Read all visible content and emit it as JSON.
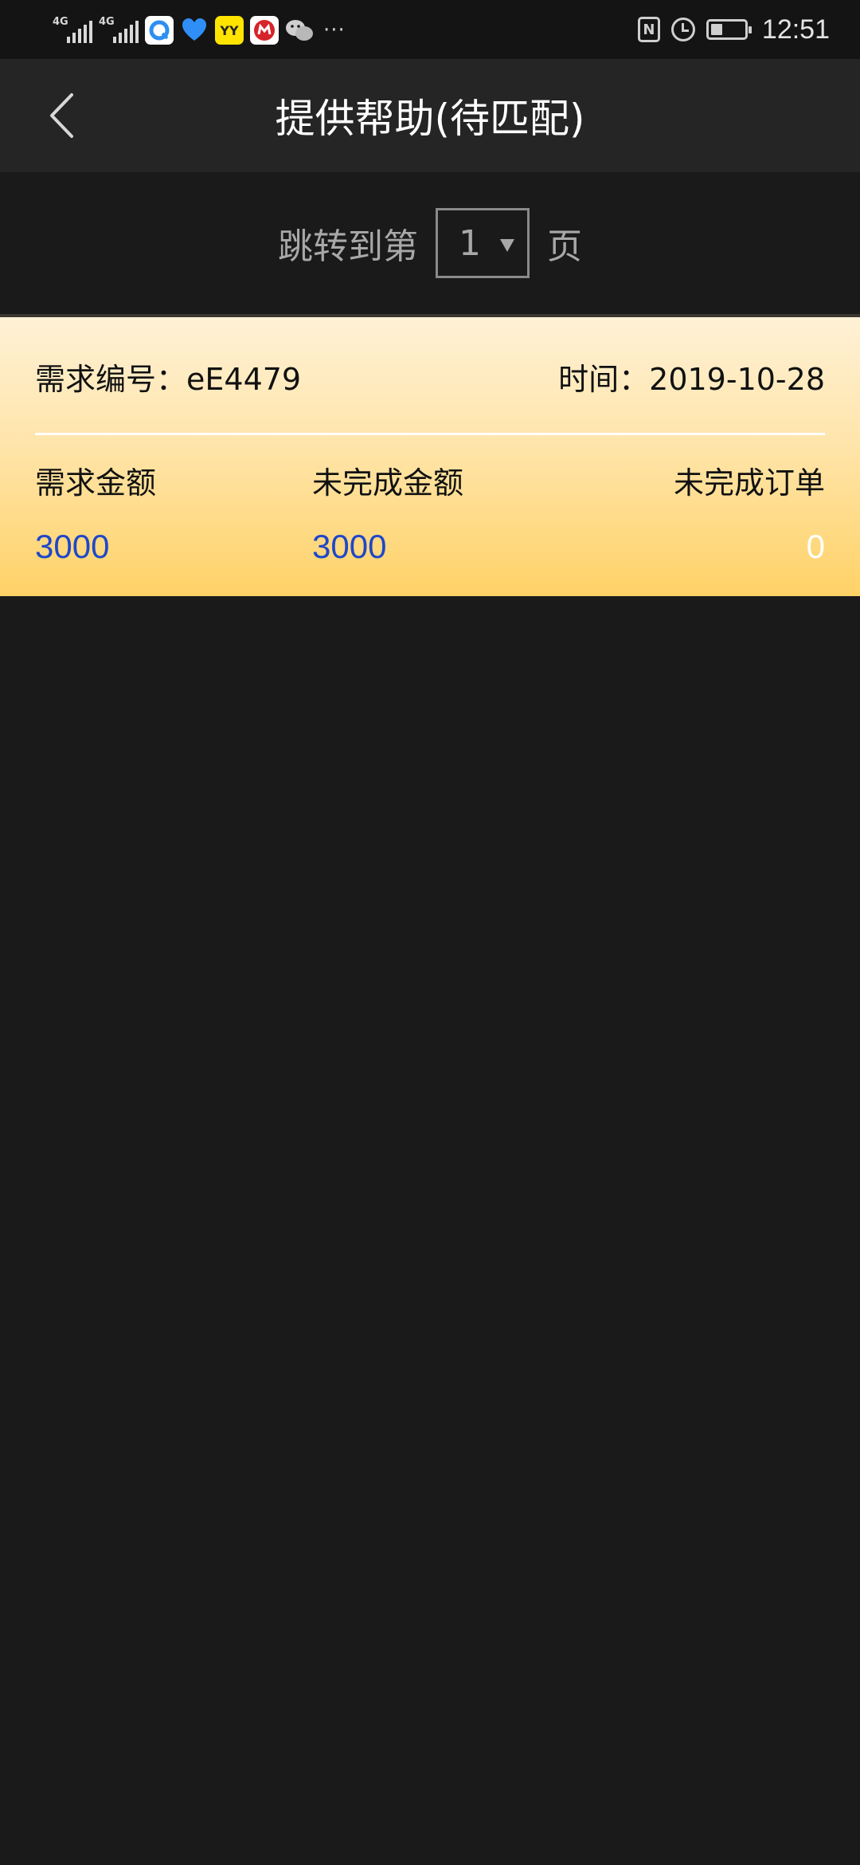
{
  "status_bar": {
    "signal1": "4G",
    "signal2": "4G",
    "apps": [
      "browser-icon",
      "heart-app-icon",
      "yy-icon",
      "bank-icon",
      "wechat-icon"
    ],
    "yy_label": "YY",
    "more": "···",
    "nfc": "N",
    "time": "12:51"
  },
  "header": {
    "title": "提供帮助(待匹配)"
  },
  "pager": {
    "prefix": "跳转到第",
    "selected_page": "1",
    "suffix": "页"
  },
  "card": {
    "id_label": "需求编号：",
    "id_value": "eE4479",
    "time_label": "时间：",
    "time_value": "2019-10-28",
    "columns": [
      {
        "label": "需求金额",
        "value": "3000"
      },
      {
        "label": "未完成金额",
        "value": "3000"
      },
      {
        "label": "未完成订单",
        "value": "0"
      }
    ]
  },
  "colors": {
    "background": "#1a1a1a",
    "header": "#252525",
    "card_top": "#fff1d6",
    "card_bottom": "#ffd267",
    "amount_blue": "#1f47c9"
  }
}
